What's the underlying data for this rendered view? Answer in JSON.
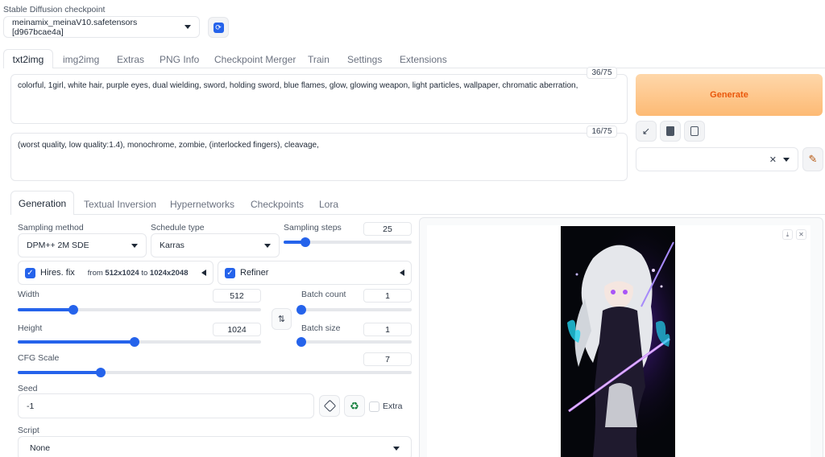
{
  "checkpoint": {
    "label": "Stable Diffusion checkpoint",
    "value": "meinamix_meinaV10.safetensors [d967bcae4a]"
  },
  "main_tabs": [
    {
      "label": "txt2img"
    },
    {
      "label": "img2img"
    },
    {
      "label": "Extras"
    },
    {
      "label": "PNG Info"
    },
    {
      "label": "Checkpoint Merger"
    },
    {
      "label": "Train"
    },
    {
      "label": "Settings"
    },
    {
      "label": "Extensions"
    }
  ],
  "prompt": {
    "value": "colorful, 1girl, white hair, purple eyes, dual wielding, sword, holding sword, blue flames, glow, glowing weapon, light particles, wallpaper, chromatic aberration,",
    "counter": "36/75"
  },
  "negative_prompt": {
    "value": "(worst quality, low quality:1.4), monochrome, zombie, (interlocked fingers), cleavage,",
    "counter": "16/75"
  },
  "generate_label": "Generate",
  "colors": {
    "accent": "#2563eb",
    "generate_from": "#fed7aa",
    "generate_to": "#fdba74",
    "generate_text": "#ea580c"
  },
  "sub_tabs": [
    {
      "label": "Generation"
    },
    {
      "label": "Textual Inversion"
    },
    {
      "label": "Hypernetworks"
    },
    {
      "label": "Checkpoints"
    },
    {
      "label": "Lora"
    }
  ],
  "sampling_method": {
    "label": "Sampling method",
    "value": "DPM++ 2M SDE"
  },
  "schedule_type": {
    "label": "Schedule type",
    "value": "Karras"
  },
  "sampling_steps": {
    "label": "Sampling steps",
    "value": "25",
    "fraction": 0.17
  },
  "hires": {
    "label": "Hires. fix",
    "from_text": "from",
    "from_value": "512x1024",
    "to_text": "to",
    "to_value": "1024x2048"
  },
  "refiner": {
    "label": "Refiner"
  },
  "width": {
    "label": "Width",
    "value": "512",
    "fraction": 0.23
  },
  "height": {
    "label": "Height",
    "value": "1024",
    "fraction": 0.48
  },
  "batch_count": {
    "label": "Batch count",
    "value": "1",
    "fraction": 0.0
  },
  "batch_size": {
    "label": "Batch size",
    "value": "1",
    "fraction": 0.0
  },
  "cfg_scale": {
    "label": "CFG Scale",
    "value": "7",
    "fraction": 0.21
  },
  "seed": {
    "label": "Seed",
    "value": "-1",
    "extra_label": "Extra"
  },
  "script": {
    "label": "Script",
    "value": "None"
  }
}
